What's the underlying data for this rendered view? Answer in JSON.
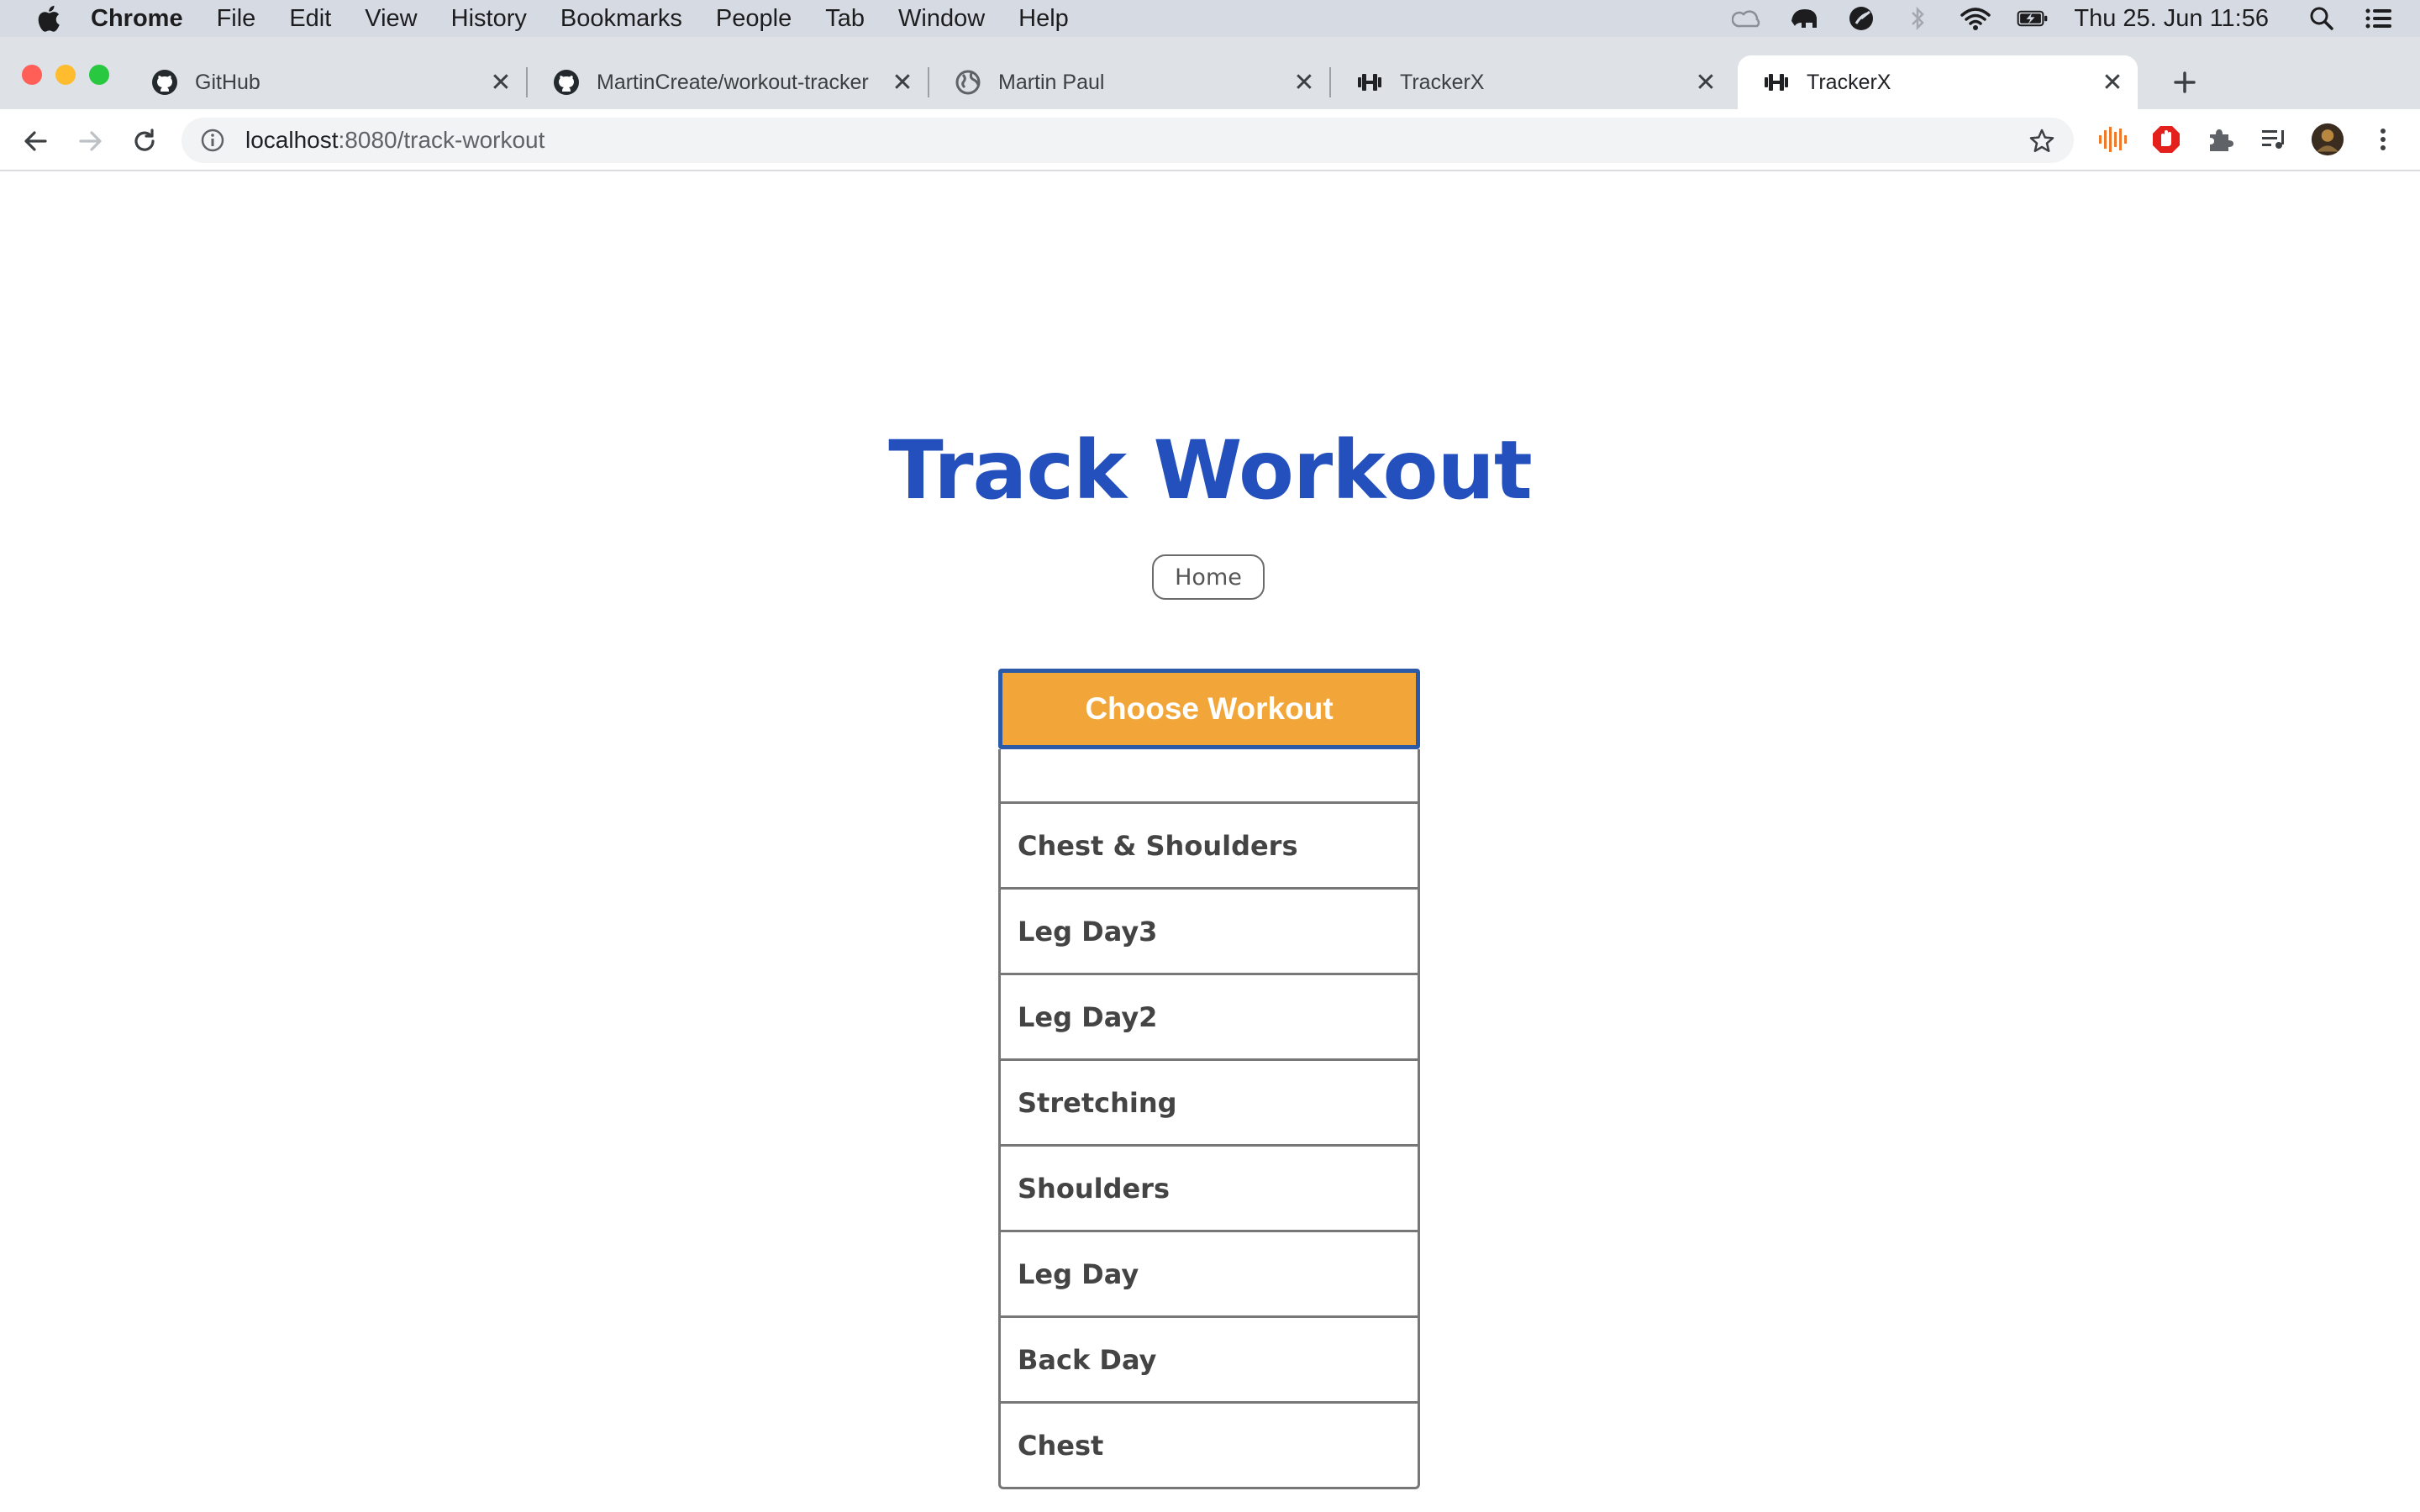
{
  "menubar": {
    "app": "Chrome",
    "items": [
      "File",
      "Edit",
      "View",
      "History",
      "Bookmarks",
      "People",
      "Tab",
      "Window",
      "Help"
    ],
    "clock": "Thu 25. Jun  11:56"
  },
  "tabs": [
    {
      "title": "GitHub",
      "icon": "github-icon"
    },
    {
      "title": "MartinCreate/workout-tracker",
      "icon": "github-icon"
    },
    {
      "title": "Martin Paul",
      "icon": "globe-icon"
    },
    {
      "title": "TrackerX",
      "icon": "dumbbell-icon"
    },
    {
      "title": "TrackerX",
      "icon": "dumbbell-icon",
      "active": true
    }
  ],
  "address": {
    "host": "localhost",
    "path": ":8080/track-workout"
  },
  "page": {
    "title": "Track Workout",
    "home_label": "Home",
    "choose_label": "Choose Workout",
    "options": [
      "Chest & Shoulders",
      "Leg Day3",
      "Leg Day2",
      "Stretching",
      "Shoulders",
      "Leg Day",
      "Back Day",
      "Chest"
    ]
  },
  "colors": {
    "title": "#2350bd",
    "choose_bg": "#f2a63a",
    "choose_border": "#2d5aa6"
  }
}
